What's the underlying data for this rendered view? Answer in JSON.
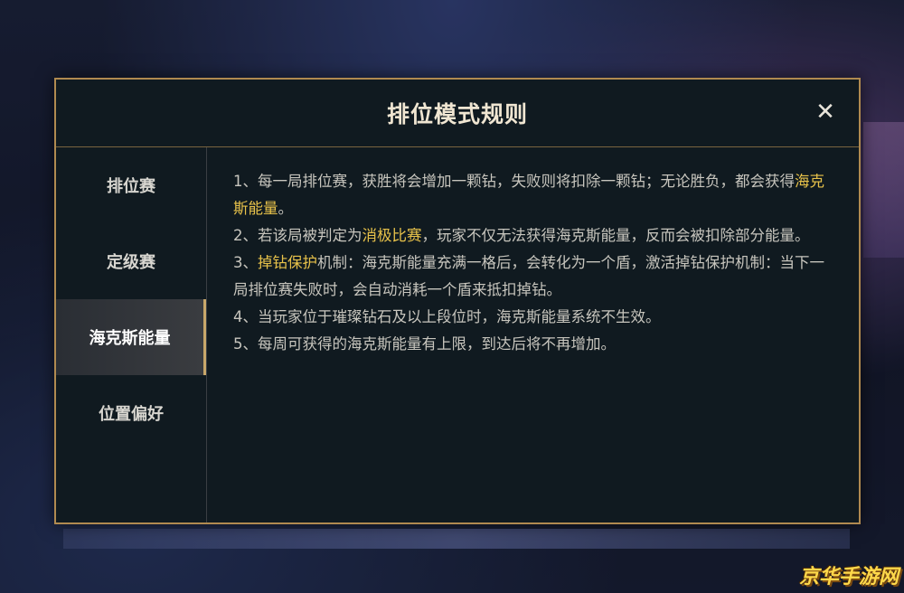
{
  "dialog": {
    "title": "排位模式规则",
    "close_glyph": "✕"
  },
  "sidebar": {
    "items": [
      {
        "label": "排位赛",
        "active": false
      },
      {
        "label": "定级赛",
        "active": false
      },
      {
        "label": "海克斯能量",
        "active": true
      },
      {
        "label": "位置偏好",
        "active": false
      }
    ]
  },
  "rules": {
    "r1_a": "1、每一局排位赛，获胜将会增加一颗钻，失败则将扣除一颗钻；无论胜负，都会获得",
    "r1_hl": "海克斯能量",
    "r1_b": "。",
    "r2_a": "2、若该局被判定为",
    "r2_hl": "消极比赛",
    "r2_b": "，玩家不仅无法获得海克斯能量，反而会被扣除部分能量。",
    "r3_a": "3、",
    "r3_hl": "掉钻保护",
    "r3_b": "机制：海克斯能量充满一格后，会转化为一个盾，激活掉钻保护机制：当下一局排位赛失败时，会自动消耗一个盾来抵扣掉钻。",
    "r4": "4、当玩家位于璀璨钻石及以上段位时，海克斯能量系统不生效。",
    "r5": "5、每周可获得的海克斯能量有上限，到达后将不再增加。"
  },
  "watermark": "京华手游网",
  "colors": {
    "accent_gold": "#b08a50",
    "highlight": "#e8c24a",
    "panel_bg": "#101a20"
  }
}
